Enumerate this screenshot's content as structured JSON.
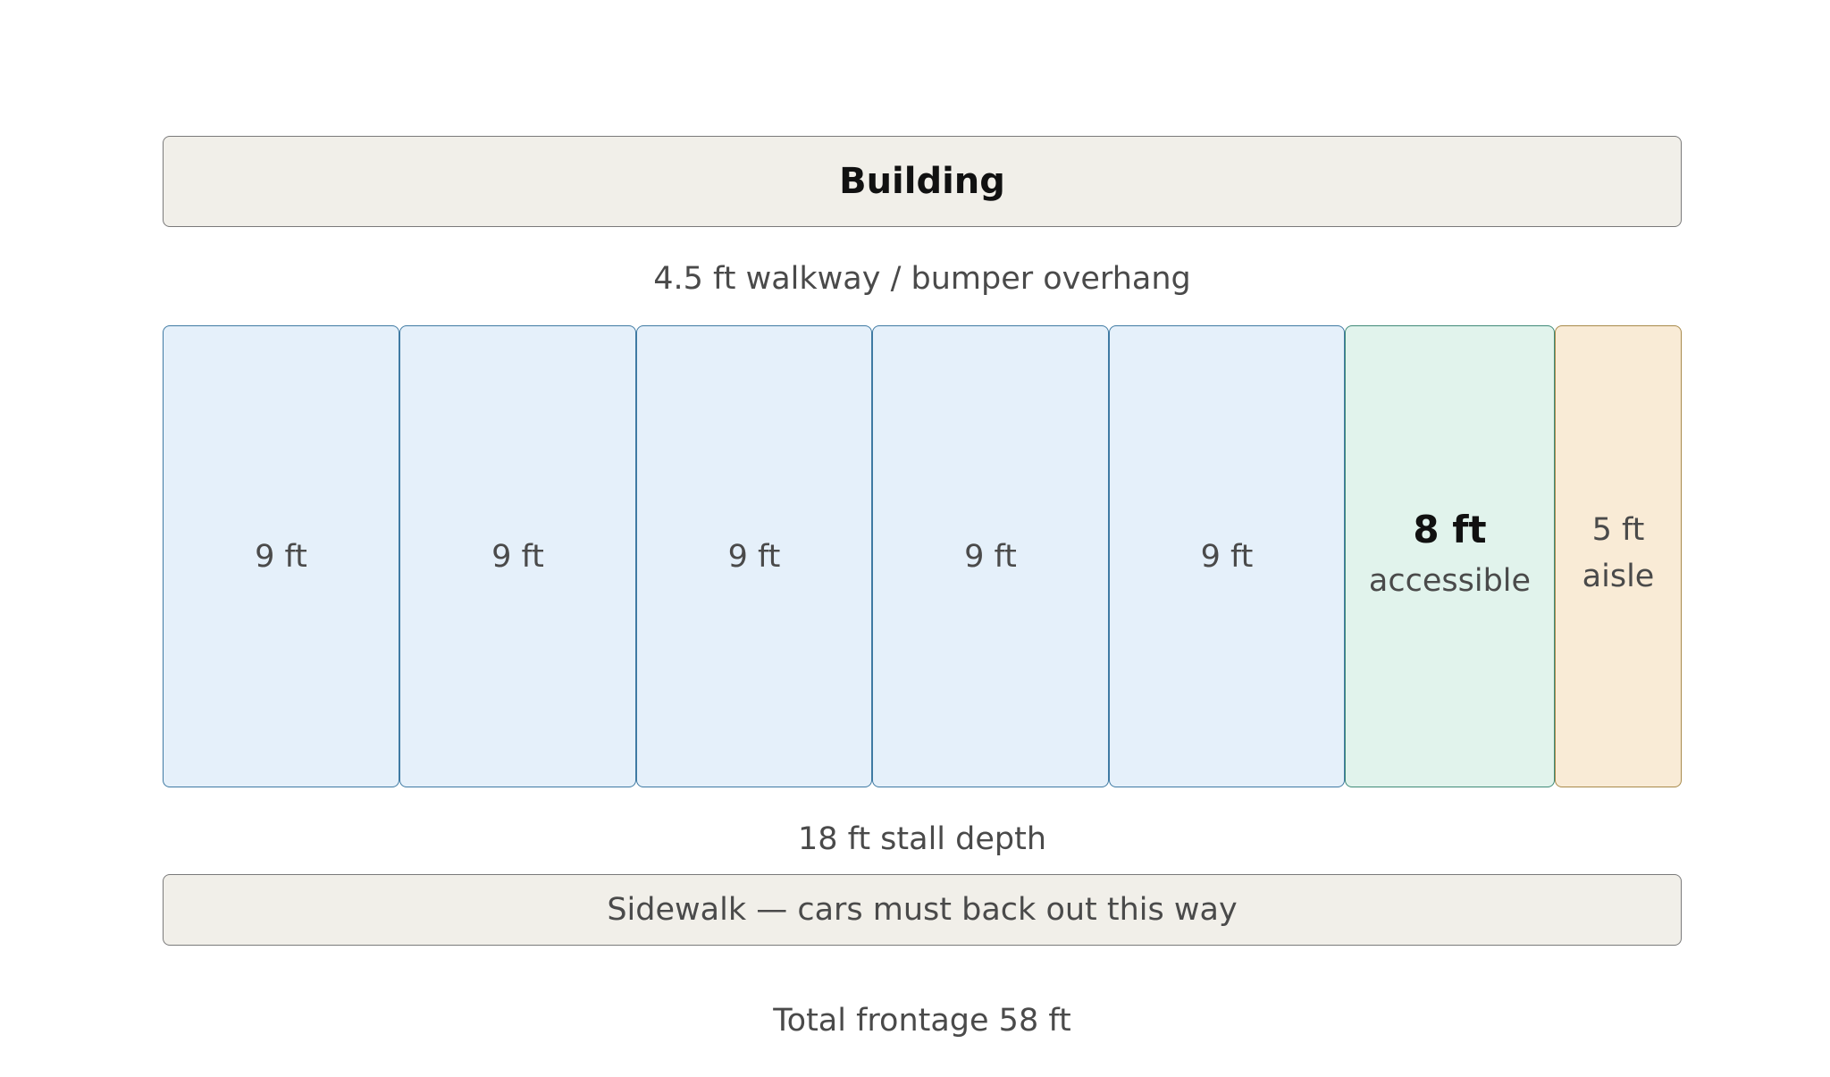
{
  "building": {
    "label": "Building"
  },
  "walkway": {
    "label": "4.5 ft walkway / bumper overhang"
  },
  "stalls": [
    {
      "width": "9 ft",
      "kind": "standard"
    },
    {
      "width": "9 ft",
      "kind": "standard"
    },
    {
      "width": "9 ft",
      "kind": "standard"
    },
    {
      "width": "9 ft",
      "kind": "standard"
    },
    {
      "width": "9 ft",
      "kind": "standard"
    },
    {
      "width": "8 ft",
      "sublabel": "accessible",
      "kind": "accessible"
    },
    {
      "width": "5 ft",
      "sublabel": "aisle",
      "kind": "aisle"
    }
  ],
  "stall_depth": {
    "label": "18 ft stall depth"
  },
  "sidewalk": {
    "label": "Sidewalk — cars must back out this way"
  },
  "total": {
    "label": "Total frontage 58 ft"
  },
  "colors": {
    "standard_fill": "#e5f0fa",
    "accessible_fill": "#e1f3ec",
    "aisle_fill": "#f9ebd6",
    "building_fill": "#f1efe9"
  }
}
